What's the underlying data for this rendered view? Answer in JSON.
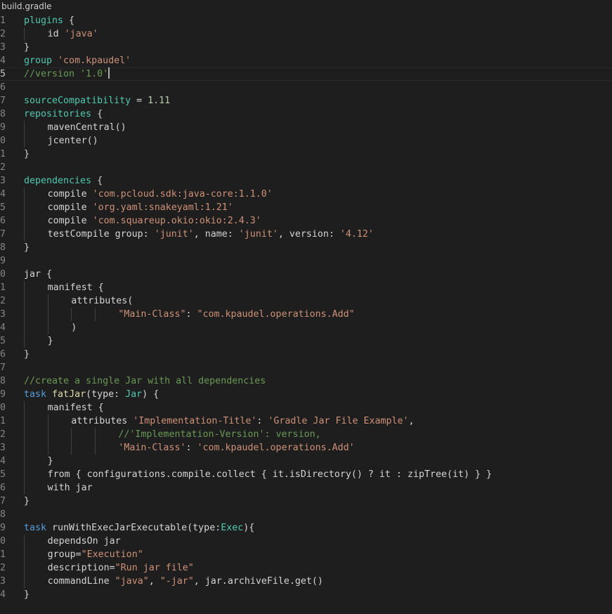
{
  "tab": {
    "title": "build.gradle"
  },
  "editor": {
    "current_line": 5,
    "lines": [
      {
        "num": "1",
        "indent": 0,
        "tokens": [
          {
            "t": "plugins",
            "c": "kw"
          },
          {
            "t": " {"
          }
        ]
      },
      {
        "num": "2",
        "indent": 1,
        "tokens": [
          {
            "t": "id "
          },
          {
            "t": "'java'",
            "c": "str"
          }
        ]
      },
      {
        "num": "3",
        "indent": 0,
        "tokens": [
          {
            "t": "}"
          }
        ]
      },
      {
        "num": "4",
        "indent": 0,
        "tokens": [
          {
            "t": "group",
            "c": "kw"
          },
          {
            "t": " "
          },
          {
            "t": "'com.kpaudel'",
            "c": "str"
          }
        ]
      },
      {
        "num": "5",
        "indent": 0,
        "caret": true,
        "tokens": [
          {
            "t": "//version '1.0'",
            "c": "cmt"
          }
        ]
      },
      {
        "num": "6",
        "indent": 0,
        "tokens": []
      },
      {
        "num": "7",
        "indent": 0,
        "tokens": [
          {
            "t": "sourceCompatibility",
            "c": "kw"
          },
          {
            "t": " = "
          },
          {
            "t": "1.11",
            "c": "num"
          }
        ]
      },
      {
        "num": "8",
        "indent": 0,
        "tokens": [
          {
            "t": "repositories",
            "c": "kw"
          },
          {
            "t": " {"
          }
        ]
      },
      {
        "num": "9",
        "indent": 1,
        "tokens": [
          {
            "t": "mavenCentral()"
          }
        ]
      },
      {
        "num": "0",
        "indent": 1,
        "tokens": [
          {
            "t": "jcenter()"
          }
        ]
      },
      {
        "num": "1",
        "indent": 0,
        "tokens": [
          {
            "t": "}"
          }
        ]
      },
      {
        "num": "2",
        "indent": 0,
        "tokens": []
      },
      {
        "num": "3",
        "indent": 0,
        "tokens": [
          {
            "t": "dependencies",
            "c": "kw"
          },
          {
            "t": " {"
          }
        ]
      },
      {
        "num": "4",
        "indent": 1,
        "tokens": [
          {
            "t": "compile "
          },
          {
            "t": "'com.pcloud.sdk:java-core:1.1.0'",
            "c": "str"
          }
        ]
      },
      {
        "num": "5",
        "indent": 1,
        "tokens": [
          {
            "t": "compile "
          },
          {
            "t": "'org.yaml:snakeyaml:1.21'",
            "c": "str"
          }
        ]
      },
      {
        "num": "6",
        "indent": 1,
        "tokens": [
          {
            "t": "compile "
          },
          {
            "t": "'com.squareup.okio:okio:2.4.3'",
            "c": "str"
          }
        ]
      },
      {
        "num": "7",
        "indent": 1,
        "tokens": [
          {
            "t": "testCompile group: "
          },
          {
            "t": "'junit'",
            "c": "str"
          },
          {
            "t": ", name: "
          },
          {
            "t": "'junit'",
            "c": "str"
          },
          {
            "t": ", version: "
          },
          {
            "t": "'4.12'",
            "c": "str"
          }
        ]
      },
      {
        "num": "8",
        "indent": 0,
        "tokens": [
          {
            "t": "}"
          }
        ]
      },
      {
        "num": "9",
        "indent": 0,
        "tokens": []
      },
      {
        "num": "0",
        "indent": 0,
        "tokens": [
          {
            "t": "jar {"
          }
        ]
      },
      {
        "num": "1",
        "indent": 1,
        "tokens": [
          {
            "t": "manifest {"
          }
        ]
      },
      {
        "num": "2",
        "indent": 2,
        "tokens": [
          {
            "t": "attributes("
          }
        ]
      },
      {
        "num": "3",
        "indent": 4,
        "tokens": [
          {
            "t": "\"Main-Class\"",
            "c": "str"
          },
          {
            "t": ": "
          },
          {
            "t": "\"com.kpaudel.operations.Add\"",
            "c": "str"
          }
        ]
      },
      {
        "num": "4",
        "indent": 2,
        "tokens": [
          {
            "t": ")"
          }
        ]
      },
      {
        "num": "5",
        "indent": 1,
        "tokens": [
          {
            "t": "}"
          }
        ]
      },
      {
        "num": "6",
        "indent": 0,
        "tokens": [
          {
            "t": "}"
          }
        ]
      },
      {
        "num": "7",
        "indent": 0,
        "tokens": []
      },
      {
        "num": "8",
        "indent": 0,
        "tokens": [
          {
            "t": "//create a single Jar with all dependencies",
            "c": "cmt"
          }
        ]
      },
      {
        "num": "9",
        "indent": 0,
        "tokens": [
          {
            "t": "task",
            "c": "blu"
          },
          {
            "t": " "
          },
          {
            "t": "fatJar",
            "c": "fn"
          },
          {
            "t": "(type: "
          },
          {
            "t": "Jar",
            "c": "kw"
          },
          {
            "t": ") {"
          }
        ]
      },
      {
        "num": "0",
        "indent": 1,
        "tokens": [
          {
            "t": "manifest {"
          }
        ]
      },
      {
        "num": "1",
        "indent": 2,
        "tokens": [
          {
            "t": "attributes "
          },
          {
            "t": "'Implementation-Title'",
            "c": "str"
          },
          {
            "t": ": "
          },
          {
            "t": "'Gradle Jar File Example'",
            "c": "str"
          },
          {
            "t": ","
          }
        ]
      },
      {
        "num": "2",
        "indent": 4,
        "tokens": [
          {
            "t": "//'Implementation-Version': version,",
            "c": "cmt"
          }
        ]
      },
      {
        "num": "3",
        "indent": 4,
        "tokens": [
          {
            "t": "'Main-Class'",
            "c": "str"
          },
          {
            "t": ": "
          },
          {
            "t": "'com.kpaudel.operations.Add'",
            "c": "str"
          }
        ]
      },
      {
        "num": "4",
        "indent": 1,
        "tokens": [
          {
            "t": "}"
          }
        ]
      },
      {
        "num": "5",
        "indent": 1,
        "tokens": [
          {
            "t": "from { configurations.compile.collect { it.isDirectory() ? it : zipTree(it) } }"
          }
        ]
      },
      {
        "num": "6",
        "indent": 1,
        "tokens": [
          {
            "t": "with jar"
          }
        ]
      },
      {
        "num": "7",
        "indent": 0,
        "tokens": [
          {
            "t": "}"
          }
        ]
      },
      {
        "num": "8",
        "indent": 0,
        "tokens": []
      },
      {
        "num": "9",
        "indent": 0,
        "tokens": [
          {
            "t": "task",
            "c": "blu"
          },
          {
            "t": " runWithExecJarExecutable(type:"
          },
          {
            "t": "Exec",
            "c": "kw"
          },
          {
            "t": "){"
          }
        ]
      },
      {
        "num": "0",
        "indent": 1,
        "tokens": [
          {
            "t": "dependsOn jar"
          }
        ]
      },
      {
        "num": "1",
        "indent": 1,
        "tokens": [
          {
            "t": "group="
          },
          {
            "t": "\"Execution\"",
            "c": "str"
          }
        ]
      },
      {
        "num": "2",
        "indent": 1,
        "tokens": [
          {
            "t": "description="
          },
          {
            "t": "\"Run jar file\"",
            "c": "str"
          }
        ]
      },
      {
        "num": "3",
        "indent": 1,
        "tokens": [
          {
            "t": "commandLine "
          },
          {
            "t": "\"java\"",
            "c": "str"
          },
          {
            "t": ", "
          },
          {
            "t": "\"-jar\"",
            "c": "str"
          },
          {
            "t": ", jar.archiveFile.get()"
          }
        ]
      },
      {
        "num": "4",
        "indent": 0,
        "tokens": [
          {
            "t": "}"
          }
        ]
      }
    ]
  }
}
